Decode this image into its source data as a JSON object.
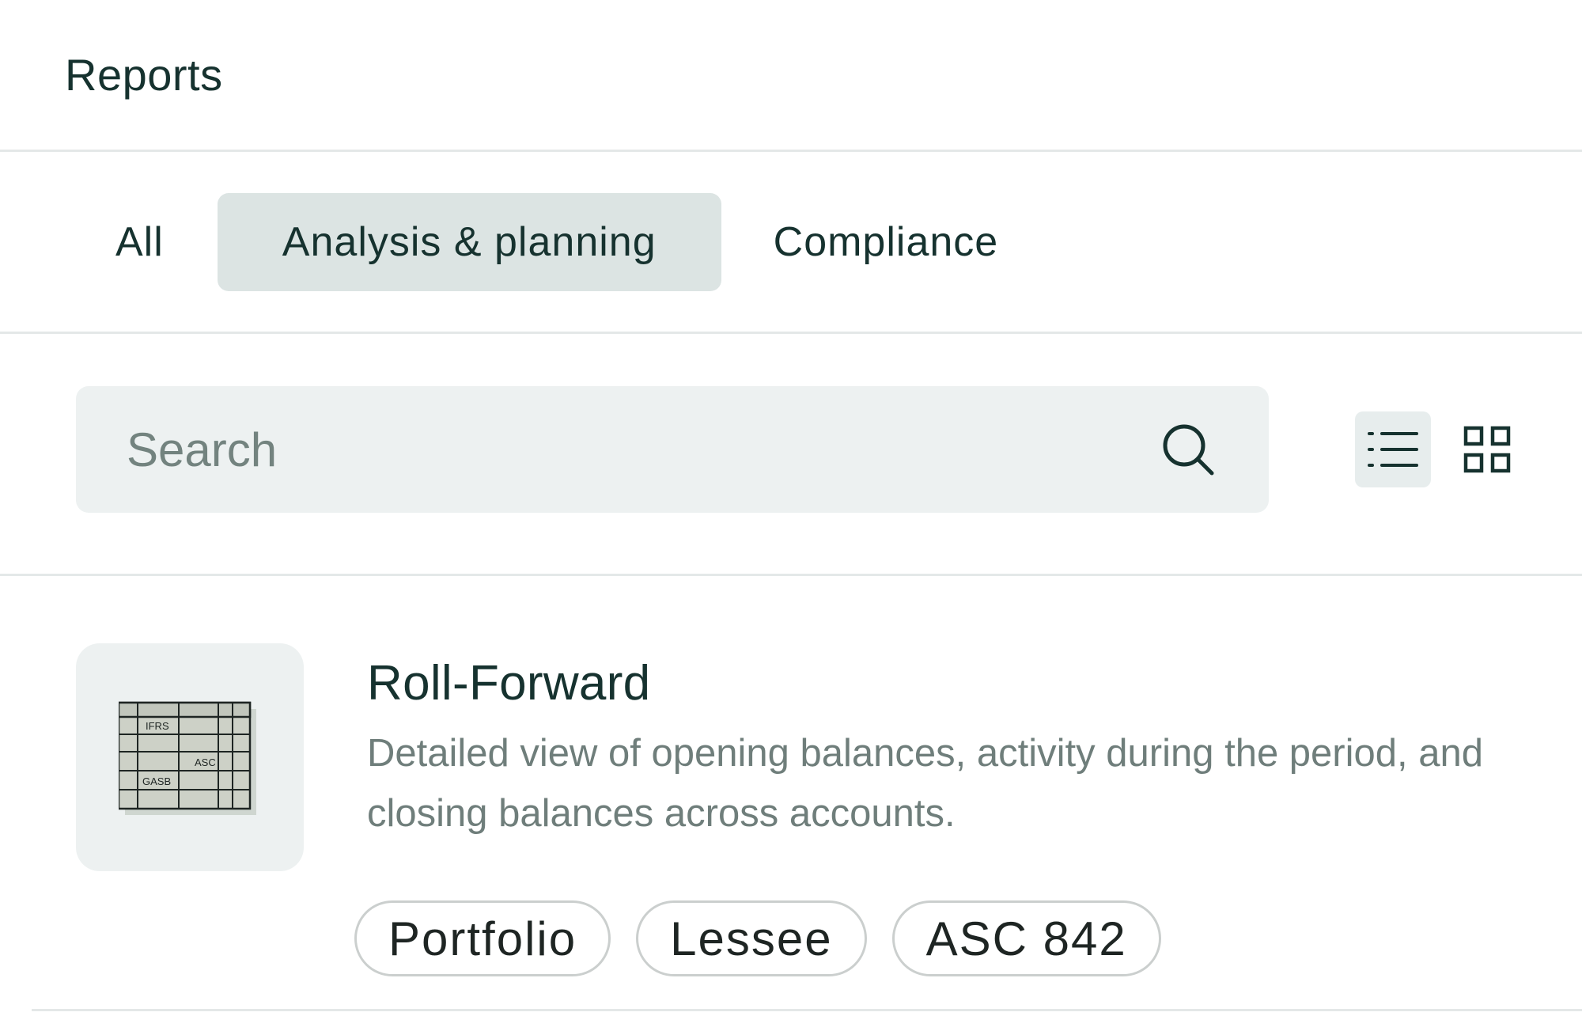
{
  "header": {
    "title": "Reports"
  },
  "tabs": [
    {
      "label": "All",
      "active": false
    },
    {
      "label": "Analysis & planning",
      "active": true
    },
    {
      "label": "Compliance",
      "active": false
    }
  ],
  "search": {
    "placeholder": "Search",
    "value": ""
  },
  "view_toggle": {
    "selected": "list",
    "options": [
      "list-view-icon",
      "grid-view-icon"
    ]
  },
  "reports": [
    {
      "title": "Roll-Forward",
      "description": "Detailed view of opening balances, activity during the period, and closing balances across accounts.",
      "thumbnail_labels": [
        "IFRS",
        "ASC",
        "GASB"
      ],
      "tags": [
        "Portfolio",
        "Lessee",
        "ASC 842"
      ]
    }
  ],
  "colors": {
    "text_primary": "#16322f",
    "text_secondary": "#6f7e7b",
    "active_tab_bg": "#dce4e3",
    "search_bg": "#edf1f1",
    "divider": "#e4e8e8"
  }
}
